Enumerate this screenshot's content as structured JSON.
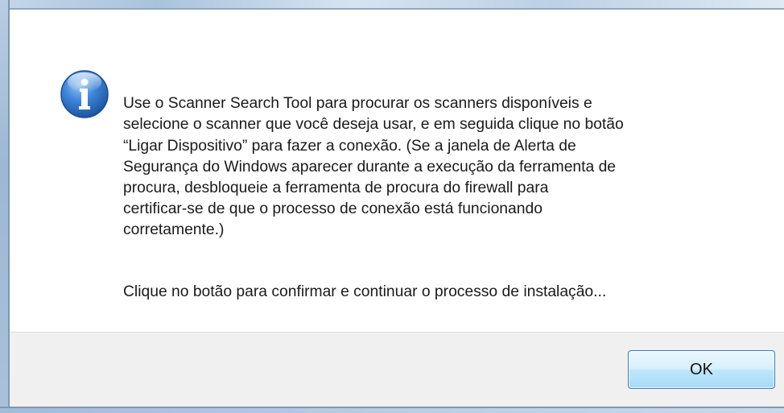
{
  "dialog": {
    "message_paragraph_1": "Use o Scanner Search Tool para procurar os scanners disponíveis e\nselecione o scanner que você deseja usar, e em seguida clique no botão\n “Ligar Dispositivo” para fazer a conexão. (Se a janela de Alerta de\nSegurança do Windows aparecer durante a execução da ferramenta de\nprocura, desbloqueie a ferramenta de procura do firewall para\ncertificar-se de que o processo de conexão está funcionando\ncorretamente.)",
    "message_paragraph_2": "Clique no botão para confirmar e continuar o processo de instalação...",
    "icon": "info-icon",
    "ok_label": "OK"
  },
  "colors": {
    "icon_blue": "#2f6fc4",
    "button_border": "#3c7fb1",
    "footer_bg": "#f0f0f0"
  }
}
